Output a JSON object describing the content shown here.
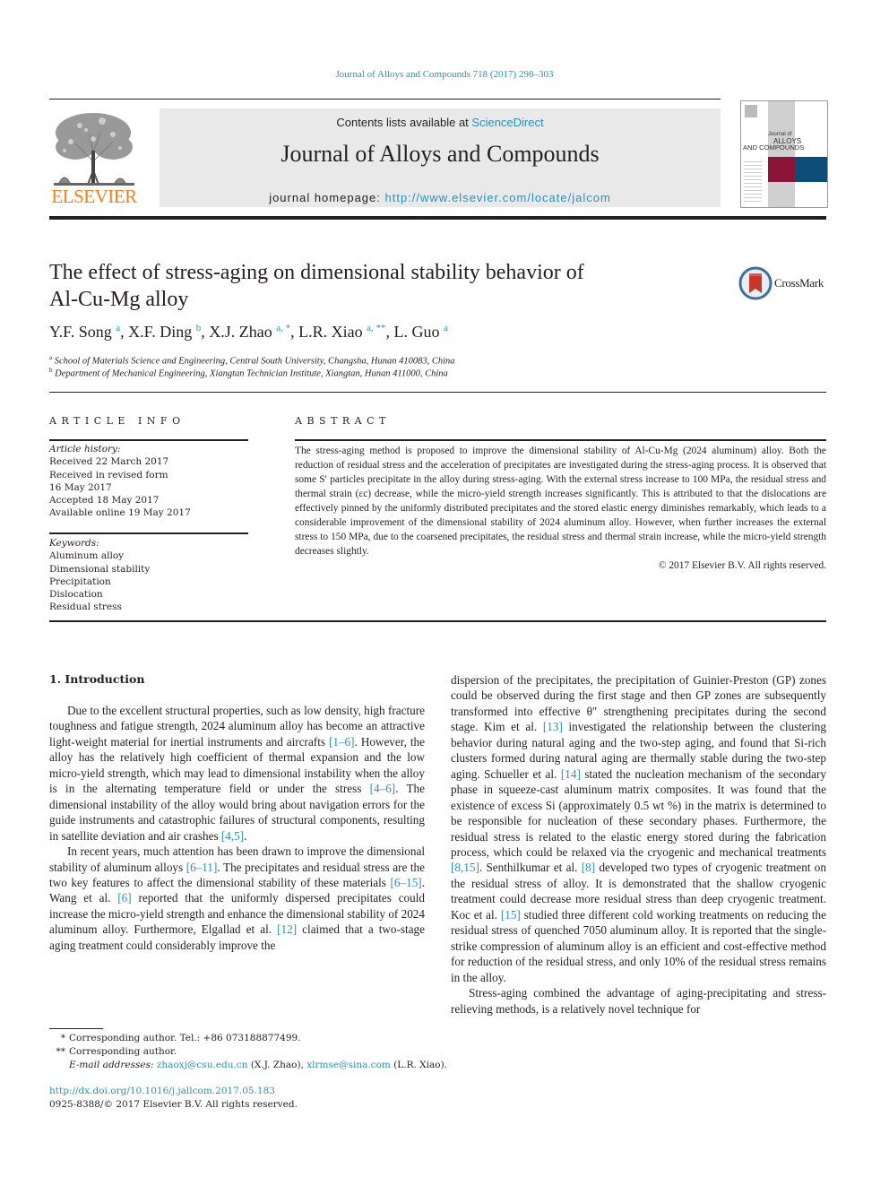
{
  "header": {
    "journal_ref": "Journal of Alloys and Compounds 718 (2017) 298–303",
    "contents_prefix": "Contents lists available at ",
    "contents_link": "ScienceDirect",
    "journal_title": "Journal of Alloys and Compounds",
    "homepage_prefix": "journal homepage: ",
    "homepage_url": "http://www.elsevier.com/locate/jalcom",
    "publisher_logo": "ELSEVIER",
    "cover_text_1": "Journal of",
    "cover_text_2": "ALLOYS",
    "cover_text_3": "AND COMPOUNDS",
    "crossmark_label": "CrossMark"
  },
  "colors": {
    "link": "#2a8fbd",
    "elsevier_orange": "#f07f1e",
    "cover_red": "#8b1538",
    "cover_blue": "#0d4e78",
    "masthead_bg": "#e9e9e9"
  },
  "article": {
    "title_line1": "The effect of stress-aging on dimensional stability behavior of",
    "title_line2": "Al-Cu-Mg alloy",
    "authors": [
      {
        "name": "Y.F. Song",
        "sup": "a",
        "sep": ", "
      },
      {
        "name": "X.F. Ding",
        "sup": "b",
        "sep": ", "
      },
      {
        "name": "X.J. Zhao",
        "sup": "a, *",
        "sep": ", "
      },
      {
        "name": "L.R. Xiao",
        "sup": "a, **",
        "sep": ", "
      },
      {
        "name": "L. Guo",
        "sup": "a",
        "sep": ""
      }
    ],
    "affiliations": [
      {
        "mark": "a",
        "text": "School of Materials Science and Engineering, Central South University, Changsha, Hunan 410083, China"
      },
      {
        "mark": "b",
        "text": "Department of Mechanical Engineering, Xiangtan Technician Institute, Xiangtan, Hunan 411000, China"
      }
    ]
  },
  "article_info": {
    "heading": "ARTICLE INFO",
    "history_label": "Article history:",
    "history": [
      "Received 22 March 2017",
      "Received in revised form",
      "16 May 2017",
      "Accepted 18 May 2017",
      "Available online 19 May 2017"
    ],
    "keywords_label": "Keywords:",
    "keywords": [
      "Aluminum alloy",
      "Dimensional stability",
      "Precipitation",
      "Dislocation",
      "Residual stress"
    ]
  },
  "abstract": {
    "heading": "ABSTRACT",
    "text": "The stress-aging method is proposed to improve the dimensional stability of Al-Cu-Mg (2024 aluminum) alloy. Both the reduction of residual stress and the acceleration of precipitates are investigated during the stress-aging process. It is observed that some S′ particles precipitate in the alloy during stress-aging. With the external stress increase to 100 MPa, the residual stress and thermal strain (εc) decrease, while the micro-yield strength increases significantly. This is attributed to that the dislocations are effectively pinned by the uniformly distributed precipitates and the stored elastic energy diminishes remarkably, which leads to a considerable improvement of the dimensional stability of 2024 aluminum alloy. However, when further increases the external stress to 150 MPa, due to the coarsened precipitates, the residual stress and thermal strain increase, while the micro-yield strength decreases slightly.",
    "copyright": "© 2017 Elsevier B.V. All rights reserved."
  },
  "body": {
    "section_heading": "1.  Introduction",
    "left_paragraphs": [
      [
        {
          "t": "Due to the excellent structural properties, such as low density, high fracture toughness and fatigue strength, 2024 aluminum alloy has become an attractive light-weight material for inertial instruments and aircrafts "
        },
        {
          "ref": "[1–6]"
        },
        {
          "t": ". However, the alloy has the relatively high coefficient of thermal expansion and the low micro-yield strength, which may lead to dimensional instability when the alloy is in the alternating temperature field or under the stress "
        },
        {
          "ref": "[4–6]"
        },
        {
          "t": ". The dimensional instability of the alloy would bring about navigation errors for the guide instruments and catastrophic failures of structural components, resulting in satellite deviation and air crashes "
        },
        {
          "ref": "[4,5]"
        },
        {
          "t": "."
        }
      ],
      [
        {
          "t": "In recent years, much attention has been drawn to improve the dimensional stability of aluminum alloys "
        },
        {
          "ref": "[6–11]"
        },
        {
          "t": ". The precipitates and residual stress are the two key features to affect the dimensional stability of these materials "
        },
        {
          "ref": "[6–15]"
        },
        {
          "t": ". Wang et al. "
        },
        {
          "ref": "[6]"
        },
        {
          "t": " reported that the uniformly dispersed precipitates could increase the micro-yield strength and enhance the dimensional stability of 2024 aluminum alloy. Furthermore, Elgallad et al. "
        },
        {
          "ref": "[12]"
        },
        {
          "t": " claimed that a two-stage aging treatment could considerably improve the"
        }
      ]
    ],
    "right_paragraphs": [
      [
        {
          "t": "dispersion of the precipitates, the precipitation of Guinier-Preston (GP) zones could be observed during the first stage and then GP zones are subsequently transformed into effective θ″ strengthening precipitates during the second stage. Kim et al. "
        },
        {
          "ref": "[13]"
        },
        {
          "t": " investigated the relationship between the clustering behavior during natural aging and the two-step aging, and found that Si-rich clusters formed during natural aging are thermally stable during the two-step aging. Schueller et al. "
        },
        {
          "ref": "[14]"
        },
        {
          "t": " stated the nucleation mechanism of the secondary phase in squeeze-cast aluminum matrix composites. It was found that the existence of excess Si (approximately 0.5 wt %) in the matrix is determined to be responsible for nucleation of these secondary phases. Furthermore, the residual stress is related to the elastic energy stored during the fabrication process, which could be relaxed via the cryogenic and mechanical treatments "
        },
        {
          "ref": "[8,15]"
        },
        {
          "t": ". Senthilkumar et al. "
        },
        {
          "ref": "[8]"
        },
        {
          "t": " developed two types of cryogenic treatment on the residual stress of alloy. It is demonstrated that the shallow cryogenic treatment could decrease more residual stress than deep cryogenic treatment. Koc et al. "
        },
        {
          "ref": "[15]"
        },
        {
          "t": " studied three different cold working treatments on reducing the residual stress of quenched 7050 aluminum alloy. It is reported that the single-strike compression of aluminum alloy is an efficient and cost-effective method for reduction of the residual stress, and only 10% of the residual stress remains in the alloy."
        }
      ],
      [
        {
          "t": "Stress-aging combined the advantage of aging-precipitating and stress-relieving methods, is a relatively novel technique for"
        }
      ]
    ]
  },
  "footnotes": {
    "fn1_mark": "*",
    "fn1_text": "Corresponding author. Tel.: +86 073188877499.",
    "fn2_mark": "**",
    "fn2_text": "Corresponding author.",
    "email_label": "E-mail addresses: ",
    "email1": "zhaoxj@csu.edu.cn",
    "email1_owner": " (X.J. Zhao), ",
    "email2": "xlrmse@sina.com",
    "email2_owner": " (L.R. Xiao).",
    "doi": "http://dx.doi.org/10.1016/j.jallcom.2017.05.183",
    "issn": "0925-8388/© 2017 Elsevier B.V. All rights reserved."
  }
}
